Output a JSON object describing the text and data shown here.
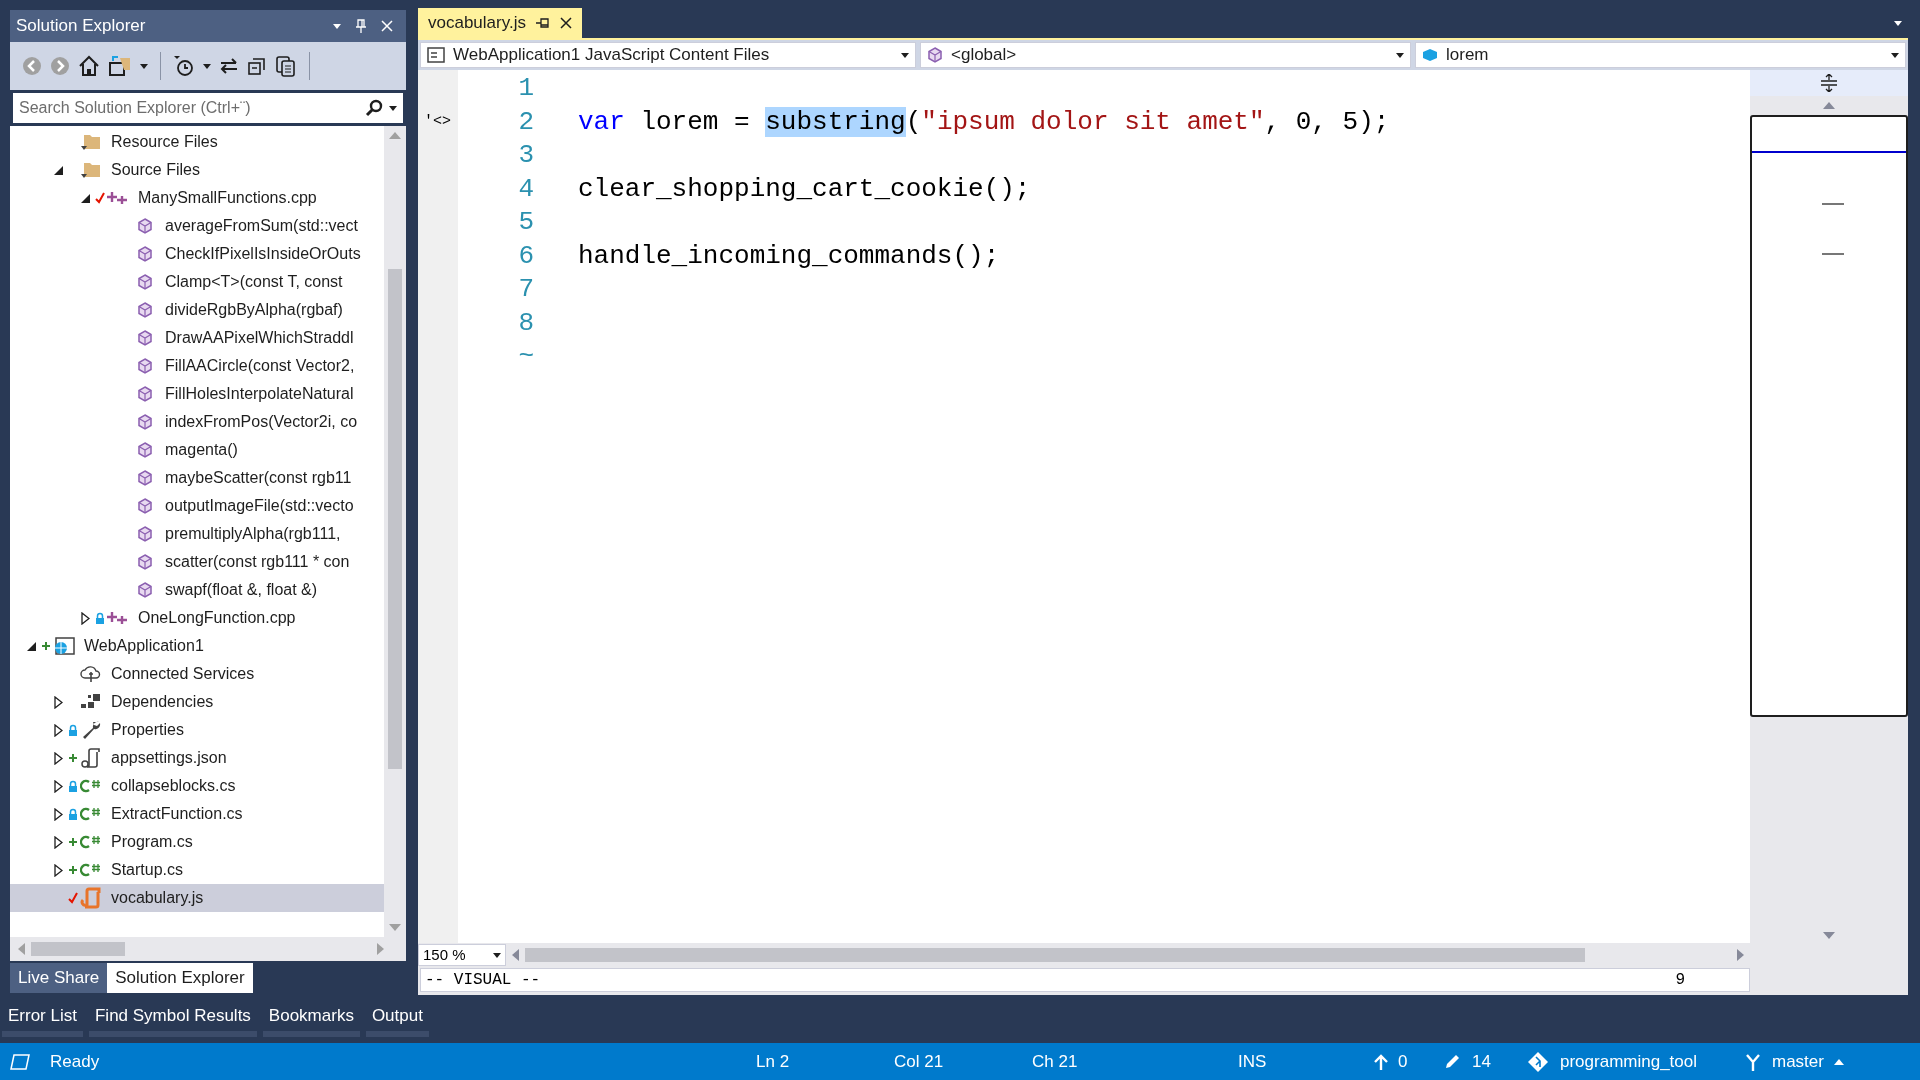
{
  "solution_explorer": {
    "title": "Solution Explorer",
    "search": {
      "placeholder": "Search Solution Explorer (Ctrl+¨)"
    },
    "tree": [
      {
        "children": [
          {
            "label": "Resource Files",
            "kind": "filter",
            "added": false,
            "locked": false,
            "checked": false,
            "selected": false
          },
          {
            "label": "Source Files",
            "kind": "filter",
            "added": false,
            "locked": false,
            "checked": false,
            "expanded": true,
            "selected": false,
            "children": [
              {
                "label": "ManySmallFunctions.cpp",
                "kind": "cpp",
                "added": false,
                "locked": false,
                "checked": true,
                "expanded": true,
                "selected": false,
                "children": [
                  {
                    "label": "averageFromSum(std::vect",
                    "kind": "function",
                    "added": false,
                    "locked": false,
                    "checked": false,
                    "selected": false
                  },
                  {
                    "label": "CheckIfPixelIsInsideOrOuts",
                    "kind": "function",
                    "added": false,
                    "locked": false,
                    "checked": false,
                    "selected": false
                  },
                  {
                    "label": "Clamp<T>(const T, const",
                    "kind": "function",
                    "added": false,
                    "locked": false,
                    "checked": false,
                    "selected": false
                  },
                  {
                    "label": "divideRgbByAlpha(rgbaf)",
                    "kind": "function",
                    "added": false,
                    "locked": false,
                    "checked": false,
                    "selected": false
                  },
                  {
                    "label": "DrawAAPixelWhichStraddl",
                    "kind": "function",
                    "added": false,
                    "locked": false,
                    "checked": false,
                    "selected": false
                  },
                  {
                    "label": "FillAACircle(const Vector2,",
                    "kind": "function",
                    "added": false,
                    "locked": false,
                    "checked": false,
                    "selected": false
                  },
                  {
                    "label": "FillHolesInterpolateNatural",
                    "kind": "function",
                    "added": false,
                    "locked": false,
                    "checked": false,
                    "selected": false
                  },
                  {
                    "label": "indexFromPos(Vector2i, co",
                    "kind": "function",
                    "added": false,
                    "locked": false,
                    "checked": false,
                    "selected": false
                  },
                  {
                    "label": "magenta()",
                    "kind": "function",
                    "added": false,
                    "locked": false,
                    "checked": false,
                    "selected": false
                  },
                  {
                    "label": "maybeScatter(const rgb11",
                    "kind": "function",
                    "added": false,
                    "locked": false,
                    "checked": false,
                    "selected": false
                  },
                  {
                    "label": "outputImageFile(std::vecto",
                    "kind": "function",
                    "added": false,
                    "locked": false,
                    "checked": false,
                    "selected": false
                  },
                  {
                    "label": "premultiplyAlpha(rgb111,",
                    "kind": "function",
                    "added": false,
                    "locked": false,
                    "checked": false,
                    "selected": false
                  },
                  {
                    "label": "scatter(const rgb111 * con",
                    "kind": "function",
                    "added": false,
                    "locked": false,
                    "checked": false,
                    "selected": false
                  },
                  {
                    "label": "swapf(float &, float &)",
                    "kind": "function",
                    "added": false,
                    "locked": false,
                    "checked": false,
                    "selected": false
                  }
                ]
              },
              {
                "label": "OneLongFunction.cpp",
                "kind": "cpp",
                "added": false,
                "locked": true,
                "checked": false,
                "expanded": false,
                "selected": false
              }
            ]
          }
        ]
      },
      {
        "label": "WebApplication1",
        "kind": "web",
        "added": true,
        "locked": false,
        "checked": false,
        "expanded": true,
        "selected": false,
        "children": [
          {
            "label": "Connected Services",
            "kind": "services",
            "added": false,
            "locked": false,
            "checked": false,
            "selected": false
          },
          {
            "label": "Dependencies",
            "kind": "dependencies",
            "added": false,
            "locked": false,
            "checked": false,
            "expanded": false,
            "selected": false
          },
          {
            "label": "Properties",
            "kind": "properties",
            "added": false,
            "locked": true,
            "checked": false,
            "expanded": false,
            "selected": false
          },
          {
            "label": "appsettings.json",
            "kind": "json",
            "added": true,
            "locked": false,
            "checked": false,
            "expanded": false,
            "selected": false
          },
          {
            "label": "collapseblocks.cs",
            "kind": "csharp",
            "added": false,
            "locked": true,
            "checked": false,
            "expanded": false,
            "selected": false
          },
          {
            "label": "ExtractFunction.cs",
            "kind": "csharp",
            "added": false,
            "locked": true,
            "checked": false,
            "expanded": false,
            "selected": false
          },
          {
            "label": "Program.cs",
            "kind": "csharp",
            "added": true,
            "locked": false,
            "checked": false,
            "expanded": false,
            "selected": false
          },
          {
            "label": "Startup.cs",
            "kind": "csharp",
            "added": true,
            "locked": false,
            "checked": false,
            "expanded": false,
            "selected": false
          },
          {
            "label": "vocabulary.js",
            "kind": "javascript",
            "added": false,
            "locked": false,
            "checked": true,
            "selected": true
          }
        ]
      }
    ],
    "tabs": [
      {
        "label": "Live Share",
        "selected": false
      },
      {
        "label": "Solution Explorer",
        "selected": true
      }
    ]
  },
  "editor": {
    "tab": {
      "label": "vocabulary.js"
    },
    "nav": [
      "WebApplication1 JavaScript Content Files",
      "<global>",
      "lorem"
    ],
    "lines": [
      {
        "number": "1"
      },
      {
        "number": "2",
        "margin": "'<>",
        "tokens": [
          {
            "text": "var",
            "kind": "keyword"
          },
          {
            "text": " lorem = ",
            "kind": "plain"
          },
          {
            "text": "substring",
            "kind": "selected"
          },
          {
            "text": "(",
            "kind": "plain"
          },
          {
            "text": "\"ipsum dolor sit amet\"",
            "kind": "string"
          },
          {
            "text": ", 0, 5);",
            "kind": "plain"
          }
        ]
      },
      {
        "number": "3"
      },
      {
        "number": "4",
        "tokens": [
          {
            "text": "clear_shopping_cart_cookie();",
            "kind": "plain"
          }
        ]
      },
      {
        "number": "5"
      },
      {
        "number": "6",
        "tokens": [
          {
            "text": "handle_incoming_commands();",
            "kind": "plain"
          }
        ]
      },
      {
        "number": "7"
      },
      {
        "number": "8"
      },
      {
        "number": "~"
      }
    ],
    "zoom": "150 %",
    "mode": "-- VISUAL --",
    "mode_count": "9"
  },
  "tool_tabs": [
    "Error List",
    "Find Symbol Results",
    "Bookmarks",
    "Output"
  ],
  "status_bar": {
    "ready": "Ready",
    "ln": "Ln 2",
    "col": "Col 21",
    "ch": "Ch 21",
    "ins": "INS",
    "pushes": "0",
    "changes": "14",
    "repo": "programming_tool",
    "branch": "master"
  }
}
